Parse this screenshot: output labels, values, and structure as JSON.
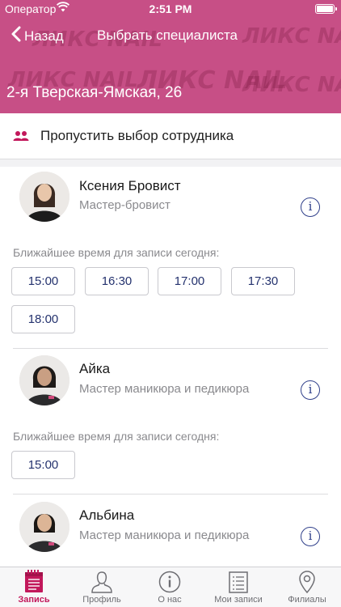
{
  "status_bar": {
    "carrier": "Оператор",
    "time": "2:51 PM"
  },
  "nav": {
    "back_label": "Назад",
    "title": "Выбрать специалиста"
  },
  "header": {
    "address": "2-я Тверская-Ямская, 26",
    "brand_text": "ЛИКС NAIL",
    "background": "#c74f86"
  },
  "skip": {
    "label": "Пропустить выбор сотрудника",
    "icon": "people-icon"
  },
  "slots_caption": "Ближайшее время для записи сегодня:",
  "specialists": [
    {
      "name": "Ксения Бровист",
      "role": "Мастер-бровист",
      "slots": [
        "15:00",
        "16:30",
        "17:00",
        "17:30",
        "18:00"
      ]
    },
    {
      "name": "Айка",
      "role": "Мастер маникюра и педикюра",
      "slots": [
        "15:00"
      ]
    },
    {
      "name": "Альбина",
      "role": "Мастер маникюра и педикюра",
      "slots": []
    }
  ],
  "tabs": [
    {
      "label": "Запись",
      "icon": "calendar-icon",
      "active": true
    },
    {
      "label": "Профиль",
      "icon": "profile-icon",
      "active": false
    },
    {
      "label": "О нас",
      "icon": "info-icon",
      "active": false
    },
    {
      "label": "Мои записи",
      "icon": "list-icon",
      "active": false
    },
    {
      "label": "Филиалы",
      "icon": "location-pin-icon",
      "active": false
    }
  ],
  "colors": {
    "accent": "#c2185b",
    "slot_text": "#24326e",
    "info": "#2f3f8a"
  }
}
